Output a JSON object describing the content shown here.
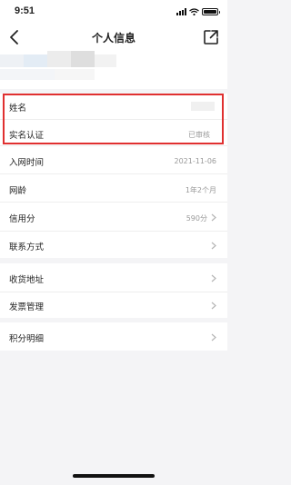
{
  "status_bar": {
    "time": "9:51"
  },
  "nav": {
    "title": "个人信息"
  },
  "rows": {
    "name": {
      "label": "姓名"
    },
    "verify": {
      "label": "实名认证",
      "value": "已审核"
    },
    "join": {
      "label": "入网时间",
      "value": "2021-11-06"
    },
    "age": {
      "label": "网龄",
      "value": "1年2个月"
    },
    "credit": {
      "label": "信用分",
      "value": "590分"
    },
    "contact": {
      "label": "联系方式"
    },
    "address": {
      "label": "收货地址"
    },
    "invoice": {
      "label": "发票管理"
    },
    "points": {
      "label": "积分明细"
    }
  },
  "colors": {
    "highlight": "#e03030",
    "background": "#f4f4f6",
    "row": "#ffffff",
    "muted": "#9a9a9a"
  }
}
